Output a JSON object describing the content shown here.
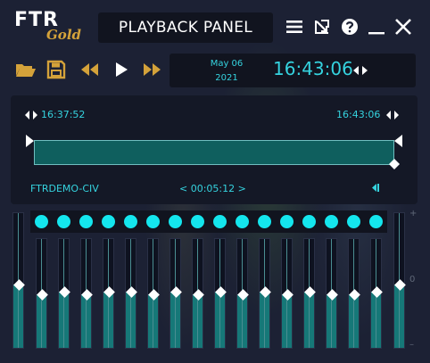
{
  "logo": {
    "primary": "FTR",
    "secondary": "Gold"
  },
  "window": {
    "title": "PLAYBACK PANEL",
    "controls": [
      "menu-icon",
      "detach-icon",
      "help-icon",
      "minimize-icon",
      "close-icon"
    ]
  },
  "toolbar": {
    "buttons": [
      "folder-open-icon",
      "save-icon",
      "rewind-icon",
      "play-icon",
      "fast-forward-icon"
    ],
    "date_month_day": "May 06",
    "date_year": "2021",
    "time": "16:43:06"
  },
  "timeline": {
    "start_time": "16:37:52",
    "end_time": "16:43:06",
    "recording_name": "FTRDEMO-CIV",
    "duration": "< 00:05:12 >"
  },
  "mixer": {
    "channel_count": 16,
    "channel_levels": [
      0.19,
      0.2,
      0.19,
      0.2,
      0.2,
      0.19,
      0.2,
      0.19,
      0.2,
      0.19,
      0.2,
      0.19,
      0.2,
      0.19,
      0.19,
      0.2
    ],
    "left_master_level": 0.39,
    "right_master_level": 0.39,
    "scale_labels": [
      "+",
      "0",
      "–"
    ]
  },
  "colors": {
    "accent_cyan": "#35d3df",
    "accent_gold": "#d4a23a",
    "bar_teal": "#0f5f5e",
    "background": "#1c2134"
  }
}
